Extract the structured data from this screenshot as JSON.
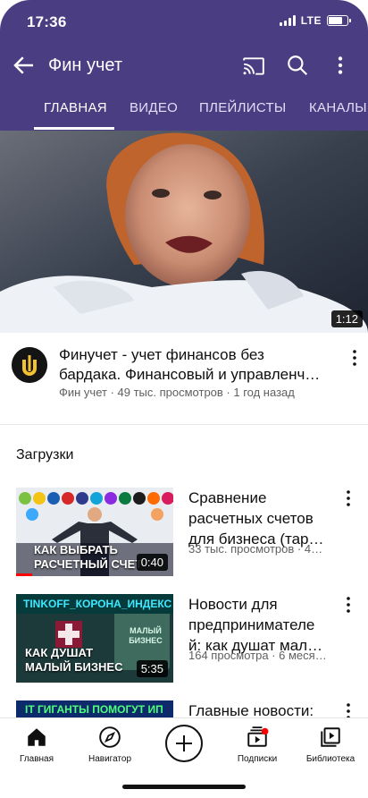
{
  "status_bar": {
    "time": "17:36",
    "network": "LTE"
  },
  "app_bar": {
    "title": "Фин учет"
  },
  "tabs": [
    {
      "label": "ГЛАВНАЯ",
      "active": true
    },
    {
      "label": "ВИДЕО"
    },
    {
      "label": "ПЛЕЙЛИСТЫ"
    },
    {
      "label": "КАНАЛЫ"
    }
  ],
  "featured": {
    "duration": "1:12",
    "title_line1": "Финучет - учет финансов без",
    "title_line2": "бардака. Финансовый и управленч…",
    "meta": "Фин учет · 49 тыс. просмотров · 1 год назад",
    "avatar_icon": "finuchet-logo-icon"
  },
  "section": {
    "title": "Загрузки"
  },
  "videos": [
    {
      "thumb_text_line1": "КАК ВЫБРАТЬ",
      "thumb_text_line2": "РАСЧЕТНЫЙ СЧЕТ",
      "duration": "0:40",
      "title_line1": "Сравнение",
      "title_line2": "расчетных счетов",
      "title_line3": "для бизнеса (тар…",
      "meta": "33 тыс. просмотров · 4…"
    },
    {
      "thumb_banner": "TINKOFF_КОРОНА_ИНДЕКС",
      "thumb_text_line1": "КАК ДУШАТ",
      "thumb_text_line2": "МАЛЫЙ БИЗНЕС",
      "thumb_board": "МАЛЫЙ БИЗНЕС",
      "duration": "5:35",
      "title_line1": "Новости для",
      "title_line2": "предпринимателе",
      "title_line3": "й: как душат мал…",
      "meta": "164 просмотра · 6 меся…"
    },
    {
      "thumb_banner": "IT ГИГАНТЫ ПОМОГУТ ИП",
      "title_line1": "Главные новости:"
    }
  ],
  "bottom_nav": [
    {
      "label": "Главная",
      "icon": "home-icon"
    },
    {
      "label": "Навигатор",
      "icon": "compass-icon"
    },
    {
      "label": "",
      "icon": "create-plus-icon"
    },
    {
      "label": "Подписки",
      "icon": "subscriptions-icon"
    },
    {
      "label": "Библиотека",
      "icon": "library-icon"
    }
  ],
  "colors": {
    "header": "#4a3d82",
    "accent_red": "#ff0000",
    "meta_gray": "#606060"
  }
}
